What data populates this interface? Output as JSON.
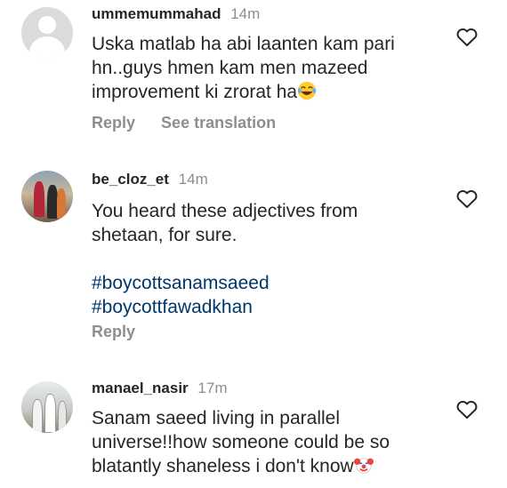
{
  "comments": [
    {
      "username": "ummemummahad",
      "time": "14m",
      "text": "Uska matlab ha abi laanten kam pari hn..guys hmen kam men mazeed improvement ki zrorat ha",
      "text_line1": "Uska matlab ha abi laanten kam pari",
      "text_line2": "hn..guys hmen kam men mazeed",
      "text_line3": "improvement ki zrorat ha",
      "emoji": "laughing-tears-emoji",
      "reply_label": "Reply",
      "translate_label": "See translation"
    },
    {
      "username": "be_cloz_et",
      "time": "14m",
      "text_line1": "You heard these adjectives from",
      "text_line2": "shetaan, for sure.",
      "hashtags": [
        "#boycottsanamsaeed",
        "#boycottfawadkhan"
      ],
      "reply_label": "Reply"
    },
    {
      "username": "manael_nasir",
      "time": "17m",
      "text_line1": "Sanam saeed living in parallel",
      "text_line2": "universe!!how someone could be so",
      "text_line3": "blatantly shaneless i don't know",
      "emoji": "clown-face-emoji"
    }
  ],
  "colors": {
    "text": "#262626",
    "meta": "#8e8e8e",
    "hashtag": "#00376b"
  }
}
